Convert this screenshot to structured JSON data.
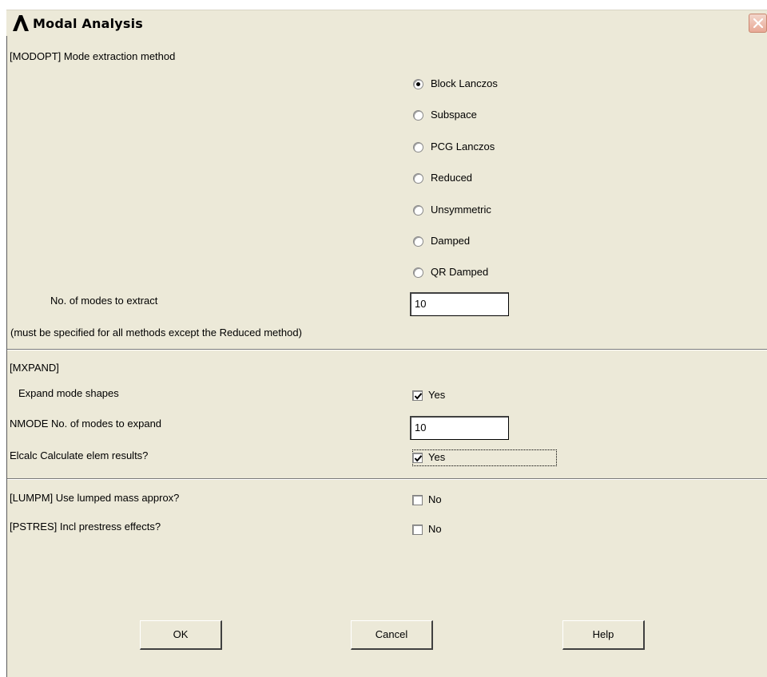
{
  "window": {
    "title": "Modal Analysis"
  },
  "modopt": {
    "header": "[MODOPT] Mode extraction method",
    "methods": [
      {
        "label": "Block Lanczos",
        "selected": true
      },
      {
        "label": "Subspace",
        "selected": false
      },
      {
        "label": "PCG Lanczos",
        "selected": false
      },
      {
        "label": "Reduced",
        "selected": false
      },
      {
        "label": "Unsymmetric",
        "selected": false
      },
      {
        "label": "Damped",
        "selected": false
      },
      {
        "label": "QR Damped",
        "selected": false
      }
    ],
    "modes_label": "No. of modes to extract",
    "modes_value": "10",
    "note": "(must be specified for all methods except the Reduced method)"
  },
  "mxpand": {
    "header": "[MXPAND]",
    "expand_label": "Expand mode shapes",
    "expand_value": "Yes",
    "expand_checked": true,
    "nmode_label": "NMODE No. of modes to expand",
    "nmode_value": "10",
    "elcalc_label": "Elcalc  Calculate elem results?",
    "elcalc_value": "Yes",
    "elcalc_checked": true
  },
  "lumpm": {
    "label": "[LUMPM]  Use lumped mass approx?",
    "value": "No",
    "checked": false
  },
  "pstres": {
    "label": "[PSTRES] Incl prestress effects?",
    "value": "No",
    "checked": false
  },
  "buttons": {
    "ok": "OK",
    "cancel": "Cancel",
    "help": "Help"
  },
  "icons": {
    "app": "ansys-logo-icon",
    "close": "close-icon",
    "check": "checkmark-icon"
  },
  "colors": {
    "dialog_bg": "#ece9d8",
    "close_button": "#e8a996"
  }
}
